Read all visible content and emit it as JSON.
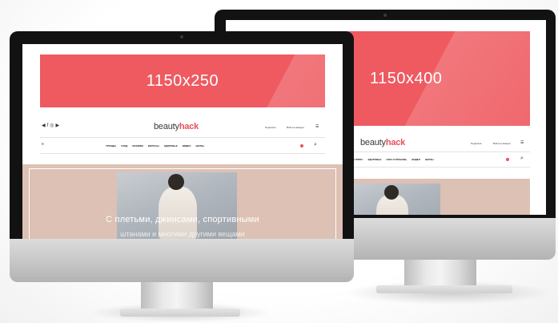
{
  "back_monitor": {
    "banner_label": "1150x400",
    "logo_main": "beauty",
    "logo_accent": "hack",
    "header_links": [
      "Подписка",
      "Войти в аккаунт"
    ],
    "nav_items": [
      "ТРЕНДЫ ПЛЮС",
      "ЗДОРОВЬЕ",
      "СЕКС И ЛЮБОВЬ",
      "ВИДЕО",
      "ШОПЫ"
    ]
  },
  "front_monitor": {
    "banner_label": "1150x250",
    "logo_main": "beauty",
    "logo_accent": "hack",
    "header_links": [
      "Подписка",
      "Войти в аккаунт"
    ],
    "nav_items": [
      "ТРЕНДЫ",
      "УХОД",
      "МАКИЯЖ",
      "ВОЛОСЫ",
      "ЗДОРОВЬЕ",
      "ВИДЕО",
      "ШОПЫ"
    ],
    "hero_headline": "С плетьми, джинсами, спортивными",
    "hero_headline_2": "штанами и многими другими вещами"
  },
  "colors": {
    "banner": "#ee5a60",
    "hero_background": "#dcc1b4",
    "logo_accent": "#e8505b",
    "bezel": "#121212"
  }
}
